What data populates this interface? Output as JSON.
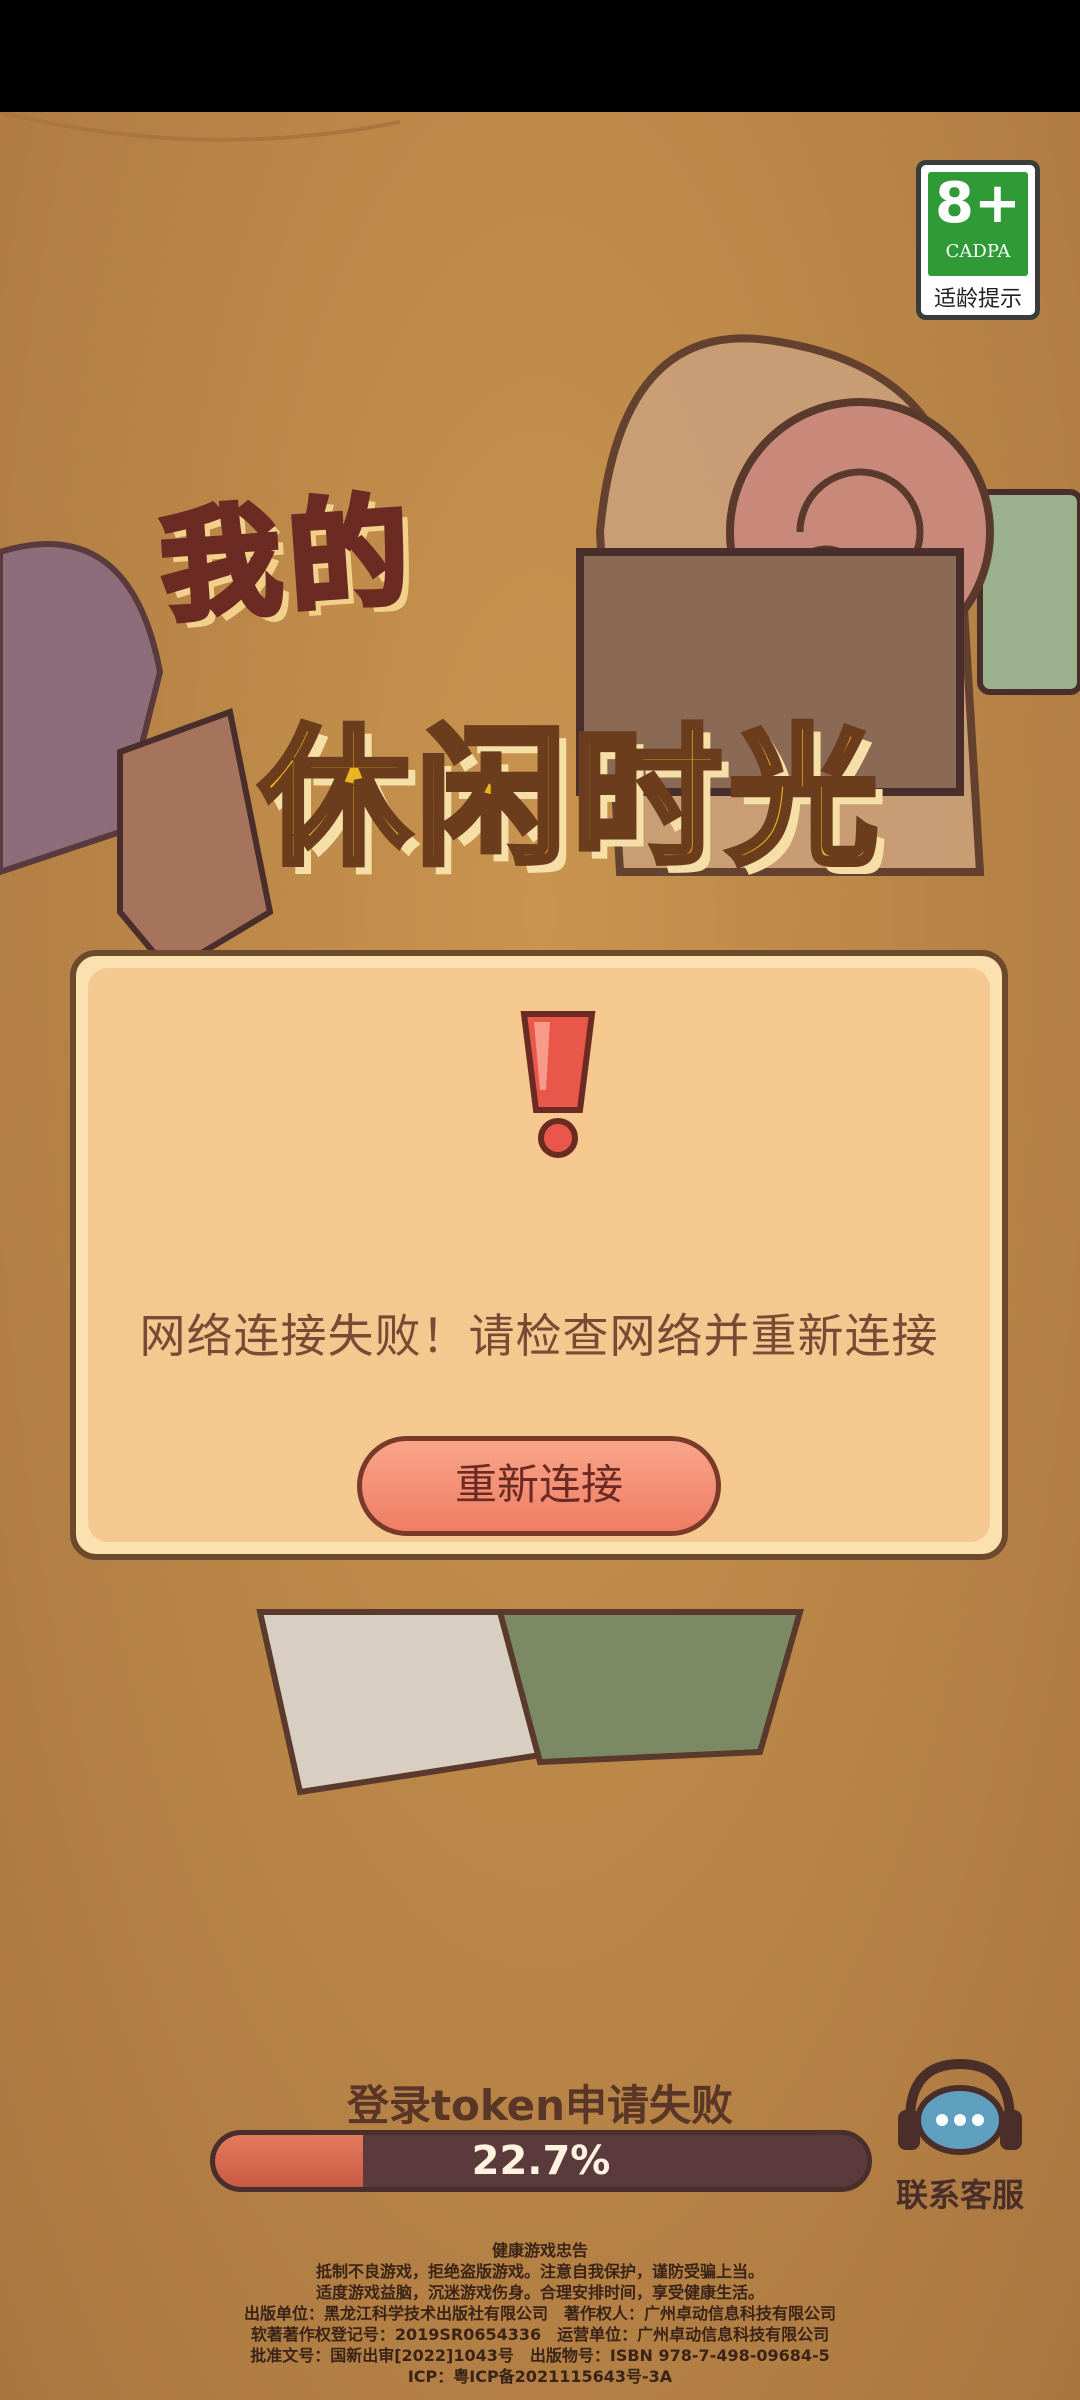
{
  "age_rating": {
    "age": "8+",
    "org": "CADPA",
    "tip": "适龄提示"
  },
  "title": {
    "line1": "我的",
    "line2": "休闲时光"
  },
  "dialog": {
    "message": "网络连接失败！请检查网络并重新连接",
    "retry_label": "重新连接"
  },
  "loading": {
    "status": "登录token申请失败",
    "progress_text": "22.7%",
    "progress_value": 0.227
  },
  "support": {
    "label": "联系客服"
  },
  "footer": {
    "lines": [
      "健康游戏忠告",
      "抵制不良游戏，拒绝盗版游戏。注意自我保护，谨防受骗上当。",
      "适度游戏益脑，沉迷游戏伤身。合理安排时间，享受健康生活。",
      "出版单位：黑龙江科学技术出版社有限公司　著作权人：广州卓动信息科技有限公司",
      "软著著作权登记号：2019SR0654336　运营单位：广州卓动信息科技有限公司",
      "批准文号：国新出审[2022]1043号　出版物号：ISBN 978-7-498-09684-5",
      "ICP：粤ICP备2021115643号-3A"
    ]
  },
  "colors": {
    "accent": "#ee7d63",
    "dialog_bg": "#f5c890",
    "text_brown": "#7a4a34"
  }
}
